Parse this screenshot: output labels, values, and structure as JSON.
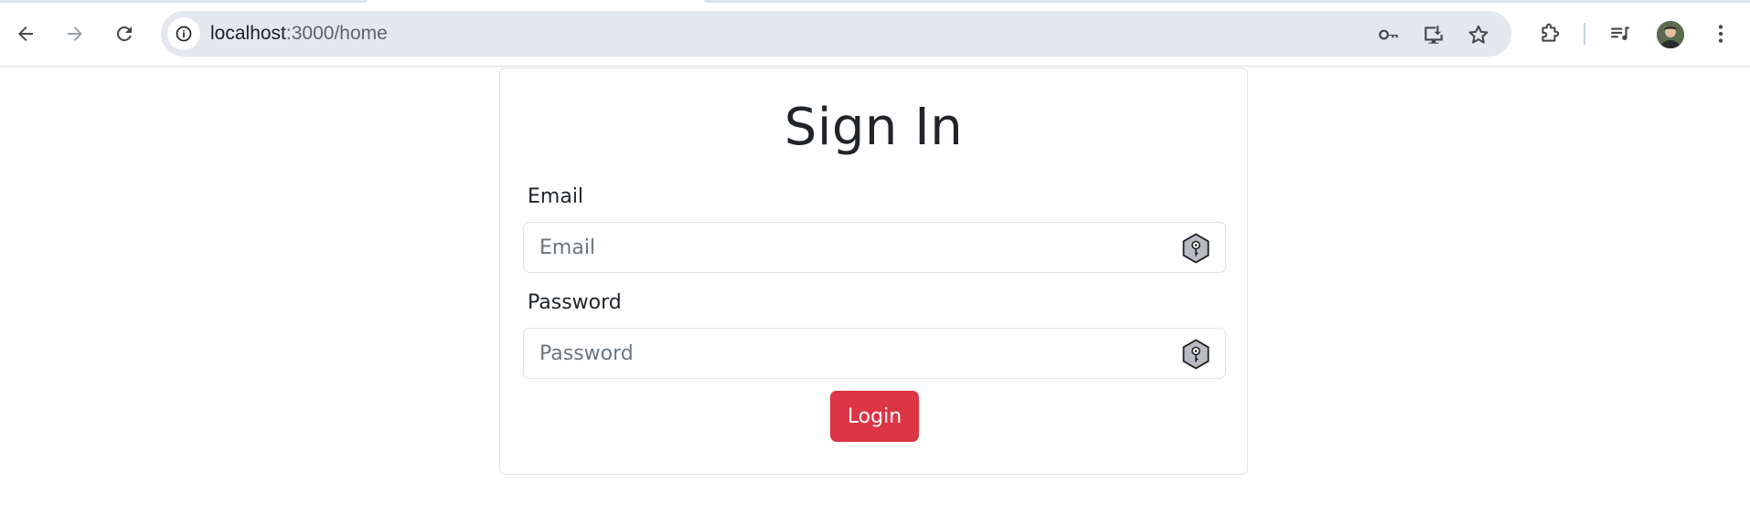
{
  "browser": {
    "url_host": "localhost",
    "url_path": ":3000/home",
    "icons": {
      "back": "arrow-left-icon",
      "forward": "arrow-right-icon",
      "reload": "reload-icon",
      "site_info": "info-icon",
      "password_key": "key-icon",
      "install_app": "install-icon",
      "bookmark": "star-icon",
      "extensions": "puzzle-icon",
      "media": "media-playlist-icon",
      "menu": "kebab-menu-icon"
    }
  },
  "form": {
    "title": "Sign In",
    "email_label": "Email",
    "email_placeholder": "Email",
    "email_value": "",
    "password_label": "Password",
    "password_placeholder": "Password",
    "password_value": "",
    "login_label": "Login"
  },
  "colors": {
    "primary_button": "#dc3545",
    "omnibox_bg": "#e3e8ef",
    "text": "#212529",
    "border": "#dee2e6"
  }
}
